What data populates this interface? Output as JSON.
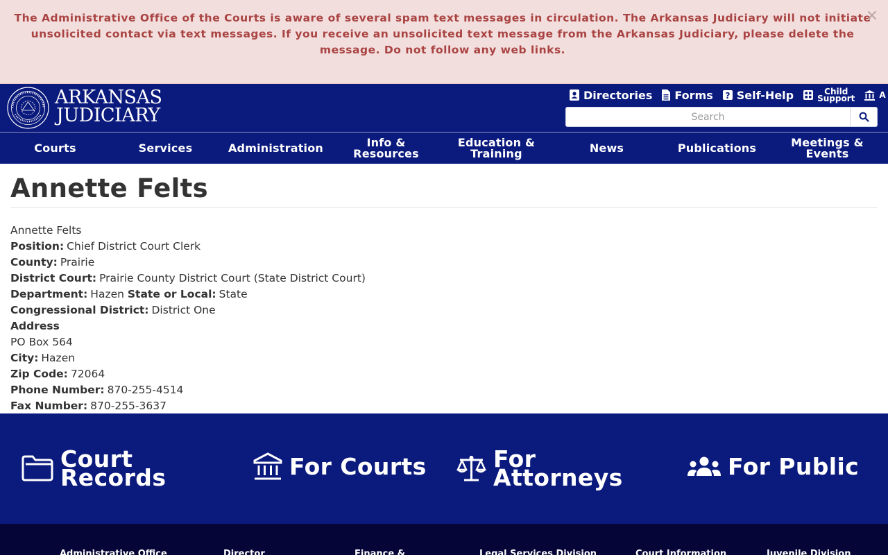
{
  "alert": {
    "message": "The Administrative Office of the Courts is aware of several spam text messages in circulation.  The Arkansas Judiciary will not initiate unsolicited contact via text messages. If you receive an unsolicited text message from the Arkansas Judiciary, please delete the message. Do not follow any web links.",
    "close_icon": "×"
  },
  "header": {
    "logo_line1": "ARKANSAS",
    "logo_line2": "JUDICIARY",
    "util_links": {
      "directories": "Directories",
      "forms": "Forms",
      "self_help": "Self-Help",
      "child_support_1": "Child",
      "child_support_2": "Support",
      "last": "A"
    },
    "search_placeholder": "Search"
  },
  "nav": {
    "courts": "Courts",
    "services": "Services",
    "administration": "Administration",
    "info_1": "Info &",
    "info_2": "Resources",
    "education_1": "Education &",
    "education_2": "Training",
    "news": "News",
    "publications": "Publications",
    "meetings_1": "Meetings &",
    "meetings_2": "Events"
  },
  "main": {
    "title": "Annette Felts",
    "name_line": "Annette Felts",
    "position_label": "Position:",
    "position": "Chief District Court Clerk",
    "county_label": "County:",
    "county": "Prairie",
    "district_court_label": "District Court:",
    "district_court": "Prairie County District Court (State District Court)",
    "department_label": "Department:",
    "department": "Hazen",
    "state_local_label": "State or Local:",
    "state_local": "State",
    "congressional_label": "Congressional District:",
    "congressional": "District One",
    "address_label": "Address",
    "address": "PO Box 564",
    "city_label": "City:",
    "city": "Hazen",
    "zip_label": "Zip Code:",
    "zip": "72064",
    "phone_label": "Phone Number:",
    "phone": "870-255-4514",
    "fax_label": "Fax Number:",
    "fax": "870-255-3637"
  },
  "quick_links": {
    "court_records_1": "Court",
    "court_records_2": "Records",
    "for_courts": "For Courts",
    "for_attorneys_1": "For",
    "for_attorneys_2": "Attorneys",
    "for_public": "For Public"
  },
  "footer": {
    "col1": "Administrative Office",
    "col2": "Director",
    "col3": "Finance &",
    "col4": "Legal Services Division",
    "col5": "Court Information",
    "col6": "Juvenile Division"
  },
  "colors": {
    "brand_navy": "#0b1a7d",
    "footer_navy": "#050537",
    "alert_bg": "#f3dede",
    "alert_text": "#a94442"
  },
  "icons": [
    "close-icon",
    "seal-logo",
    "directories-icon",
    "forms-icon",
    "self-help-icon",
    "child-support-icon",
    "bank-icon",
    "search-icon",
    "folder-icon",
    "courthouse-icon",
    "scales-icon",
    "users-icon"
  ]
}
